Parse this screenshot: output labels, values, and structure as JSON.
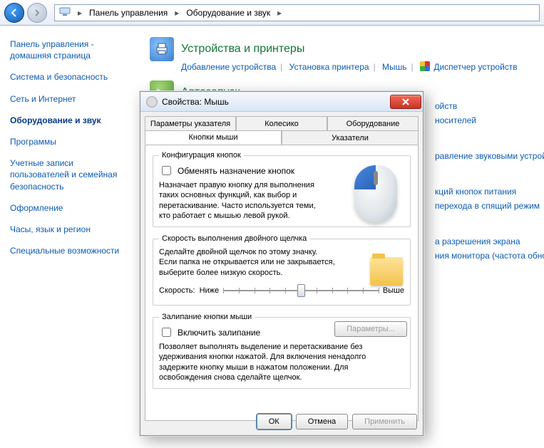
{
  "breadcrumb": {
    "root_icon": "computer-icon",
    "item1": "Панель управления",
    "item2": "Оборудование и звук"
  },
  "sidebar": {
    "home": "Панель управления - домашняя страница",
    "items": [
      "Система и безопасность",
      "Сеть и Интернет",
      "Оборудование и звук",
      "Программы",
      "Учетные записи пользователей и семейная безопасность",
      "Оформление",
      "Часы, язык и регион",
      "Специальные возможности"
    ],
    "active_index": 2
  },
  "categories": {
    "devices": {
      "title": "Устройства и принтеры",
      "links": [
        "Добавление устройства",
        "Установка принтера",
        "Мышь",
        "Диспетчер устройств"
      ],
      "shield_index": 3
    },
    "autoplay": {
      "title": "Автозапуск"
    }
  },
  "obscured_links": [
    "ойств",
    "носителей",
    "равление звуковыми устрой",
    "кций кнопок питания",
    "перехода в спящий режим",
    "а разрешения экрана",
    "ния монитора (частота обно"
  ],
  "dialog": {
    "title": "Свойства: Мышь",
    "tabs_row1": [
      "Параметры указателя",
      "Колесико",
      "Оборудование"
    ],
    "tabs_row2": [
      "Кнопки мыши",
      "Указатели"
    ],
    "active_tab": "Кнопки мыши",
    "group_buttons": {
      "legend": "Конфигурация кнопок",
      "checkbox": "Обменять назначение кнопок",
      "desc": "Назначает правую кнопку для выполнения таких основных функций, как выбор и перетаскивание. Часто используется теми, кто работает с мышью левой рукой."
    },
    "group_dblclick": {
      "legend": "Скорость выполнения двойного щелчка",
      "desc": "Сделайте двойной щелчок по этому значку. Если папка не открывается или не закрывается, выберите более низкую скорость.",
      "speed_label": "Скорость:",
      "slow": "Ниже",
      "fast": "Выше",
      "slider_pos": 0.5
    },
    "group_clicklock": {
      "legend": "Залипание кнопки мыши",
      "checkbox": "Включить залипание",
      "params_btn": "Параметры...",
      "desc": "Позволяет выполнять выделение и перетаскивание без удерживания кнопки нажатой. Для включения ненадолго задержите кнопку мыши в нажатом положении. Для освобождения снова сделайте щелчок."
    },
    "buttons": {
      "ok": "ОК",
      "cancel": "Отмена",
      "apply": "Применить"
    }
  }
}
